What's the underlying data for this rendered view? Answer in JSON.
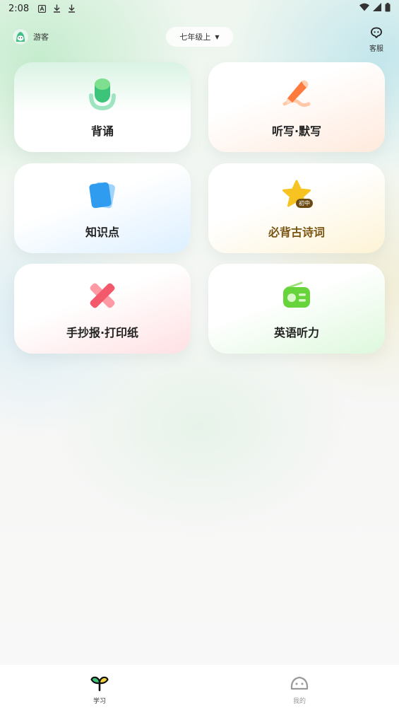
{
  "status_bar": {
    "time": "2:08",
    "left_icons": [
      "notification-a-icon",
      "download-icon",
      "download-icon"
    ],
    "right_icons": [
      "wifi-icon",
      "signal-icon",
      "battery-icon"
    ]
  },
  "header": {
    "user_name": "游客",
    "grade_selector": "七年级上",
    "service_label": "客服"
  },
  "cards": [
    {
      "label": "背诵",
      "icon": "microphone-icon",
      "accent": "#3cc47a"
    },
    {
      "label": "听写·默写",
      "icon": "pencil-icon",
      "accent": "#ff7a3d"
    },
    {
      "label": "知识点",
      "icon": "notes-icon",
      "accent": "#2f9cf0"
    },
    {
      "label": "必背古诗词",
      "icon": "star-icon",
      "badge": "初中",
      "accent": "#f7c320"
    },
    {
      "label": "手抄报·打印纸",
      "icon": "bandage-icon",
      "accent": "#f25a6b"
    },
    {
      "label": "英语听力",
      "icon": "radio-icon",
      "accent": "#67d43c"
    }
  ],
  "tabbar": {
    "tabs": [
      {
        "label": "学习",
        "icon": "sprout-icon",
        "active": true
      },
      {
        "label": "我的",
        "icon": "face-icon",
        "active": false
      }
    ]
  }
}
